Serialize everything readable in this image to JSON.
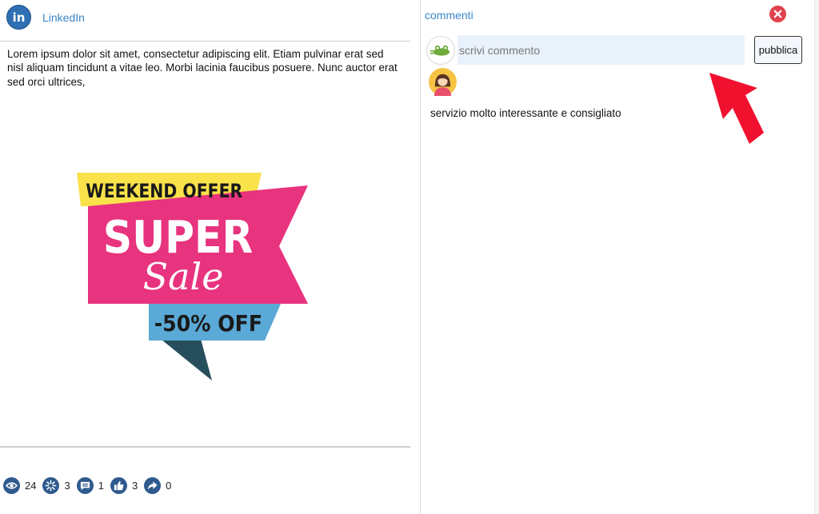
{
  "post": {
    "network_badge": "in",
    "network_name": "LinkedIn",
    "text": "Lorem ipsum dolor sit amet, consectetur adipiscing elit. Etiam pulvinar erat sed nisl aliquam tincidunt a vitae leo. Morbi lacinia faucibus posuere. Nunc auctor erat sed orci ultrices,",
    "image": {
      "line1": "WEEKEND OFFER",
      "line2": "SUPER",
      "line3": "Sale",
      "line4": "-50% OFF",
      "colors": {
        "yellow": "#f9e24a",
        "pink": "#e8337f",
        "blue": "#5aa9d6",
        "purple": "#5a1557",
        "teal": "#264e5c"
      }
    },
    "stats": [
      {
        "icon": "eye-icon",
        "count": "24"
      },
      {
        "icon": "burst-icon",
        "count": "3"
      },
      {
        "icon": "comment-icon",
        "count": "1"
      },
      {
        "icon": "thumbs-up-icon",
        "count": "3"
      },
      {
        "icon": "share-icon",
        "count": "0"
      }
    ]
  },
  "comments": {
    "title": "commenti",
    "input_placeholder": "scrivi commento",
    "publish_label": "pubblica",
    "items": [
      {
        "avatar": "woman-avatar-icon",
        "text": "servizio molto interessante e consigliato"
      }
    ]
  },
  "colors": {
    "accent": "#3a86c8",
    "close": "#e0424d",
    "icon_bg": "#2f5a8e",
    "input_bg": "#e9f1fb",
    "arrow": "#f0112f"
  }
}
